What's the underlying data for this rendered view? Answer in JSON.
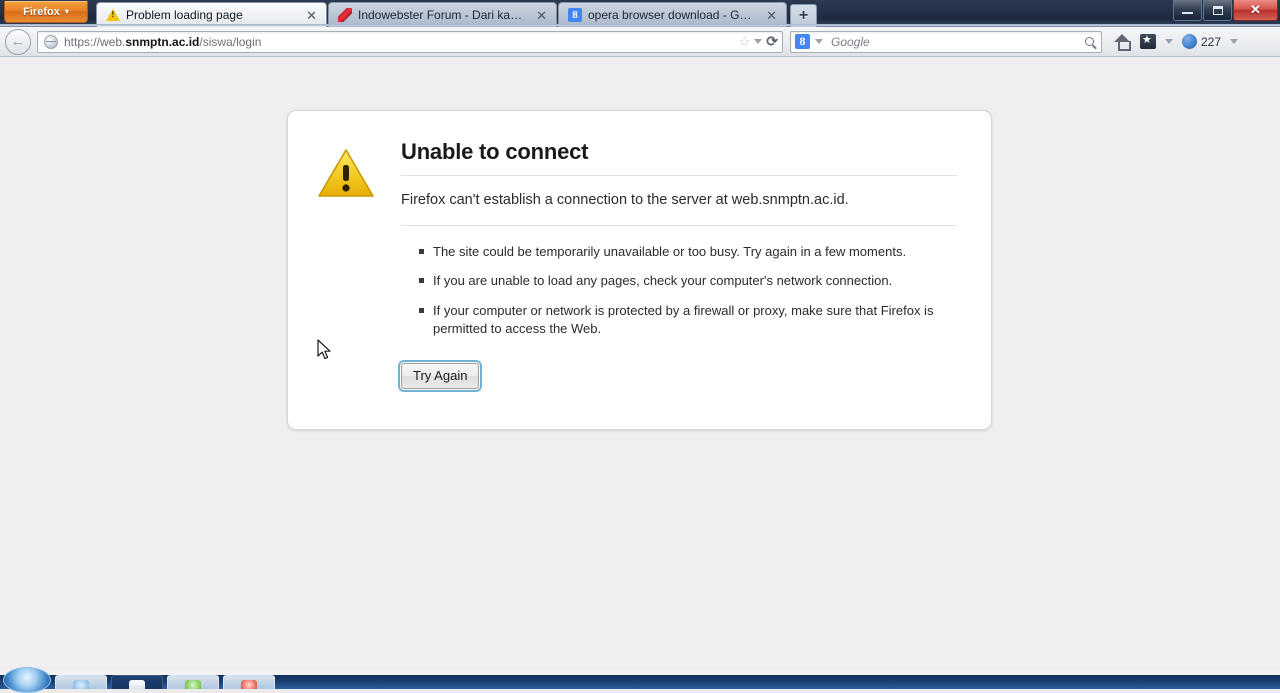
{
  "window": {
    "firefox_menu_label": "Firefox",
    "firefox_menu_caret": "▾",
    "minimize_label": "Minimize",
    "maximize_label": "Restore",
    "close_label": "Close",
    "close_glyph": "✕"
  },
  "tabs": [
    {
      "title": "Problem loading page",
      "favicon": "warning-triangle-icon",
      "active": true,
      "close_glyph": "✕"
    },
    {
      "title": "Indowebster Forum - Dari kami yang ...",
      "favicon": "indowebster-icon",
      "active": false,
      "close_glyph": "✕"
    },
    {
      "title": "opera browser download - Google Se...",
      "favicon": "google-icon",
      "favicon_text": "8",
      "active": false,
      "close_glyph": "✕"
    }
  ],
  "newtab": {
    "label": "+"
  },
  "navbar": {
    "back_glyph": "←",
    "url_prefix": "https://web.",
    "url_domain": "snmptn.ac.id",
    "url_suffix": "/siswa/login",
    "url_full": "https://web.snmptn.ac.id/siswa/login",
    "bookmark_star_glyph": "☆",
    "reload_glyph": "⟳",
    "search_engine_icon_text": "8",
    "search_placeholder": "Google",
    "home_icon": "home-icon",
    "bookmarks_icon": "bookmarks-icon",
    "sync_count": "227",
    "dropdown_caret": "▾"
  },
  "page": {
    "warning_icon": "warning-triangle-icon",
    "title": "Unable to connect",
    "description": "Firefox can't establish a connection to the server at web.snmptn.ac.id.",
    "bullets": [
      "The site could be temporarily unavailable or too busy. Try again in a few moments.",
      "If you are unable to load any pages, check your computer's network connection.",
      "If your computer or network is protected by a firewall or proxy, make sure that Firefox is permitted to access the Web."
    ],
    "try_again_label": "Try Again"
  },
  "taskbar": {
    "start_label": "Start",
    "items": [
      {
        "name": "taskbar-item-1",
        "style": "blue"
      },
      {
        "name": "taskbar-item-2",
        "style": "dark-white"
      },
      {
        "name": "taskbar-item-3",
        "style": "green"
      },
      {
        "name": "taskbar-item-4",
        "style": "red"
      }
    ]
  },
  "colors": {
    "accent_orange": "#e8842a",
    "titlebar": "#253248",
    "page_bg": "#f0eeee",
    "panel_bg": "#ffffff",
    "warning_yellow": "#f2c400",
    "focus_blue": "#6fb2d4"
  }
}
